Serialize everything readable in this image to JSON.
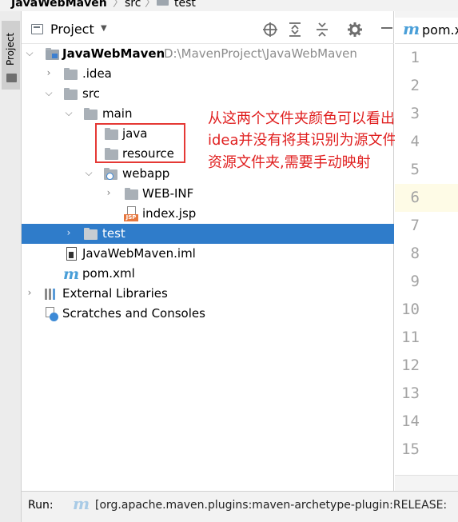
{
  "breadcrumb": {
    "project": "JavaWebMaven",
    "items": [
      "src",
      "test"
    ]
  },
  "tool_strip": {
    "project_tab": "Project"
  },
  "project_panel": {
    "title": "Project",
    "dropdown_icon": "chevron-down-icon",
    "toolbar_icons": [
      "locate-icon",
      "expand-all-icon",
      "collapse-all-icon",
      "gear-icon",
      "hide-icon"
    ]
  },
  "tree": {
    "root": {
      "name": "JavaWebMaven",
      "path": "D:\\MavenProject\\JavaWebMaven"
    },
    "idea": ".idea",
    "src": "src",
    "main": "main",
    "java": "java",
    "resource": "resource",
    "webapp": "webapp",
    "webinf": "WEB-INF",
    "indexjsp": "index.jsp",
    "test": "test",
    "iml": "JavaWebMaven.iml",
    "pom": "pom.xml",
    "external": "External Libraries",
    "scratches": "Scratches and Consoles",
    "jsp_tag": "JSP",
    "selected": "test"
  },
  "annotation": {
    "line1": "从这两个文件夹颜色可以看出,",
    "line2": "idea并没有将其识别为源文件夹和",
    "line3": "资源文件夹,需要手动映射",
    "color": "#e02020"
  },
  "editor": {
    "tab_label": "pom.xml",
    "line_numbers": [
      "1",
      "2",
      "3",
      "4",
      "5",
      "6",
      "7",
      "8",
      "9",
      "10",
      "11",
      "12",
      "13",
      "14",
      "15"
    ],
    "current_line": "6"
  },
  "run_bar": {
    "label": "Run:",
    "text": "[org.apache.maven.plugins:maven-archetype-plugin:RELEASE:"
  },
  "colors": {
    "selection": "#2f7cca",
    "folder": "#a9b0b7",
    "maven_blue": "#4a9fd8",
    "jsp_orange": "#e7773e"
  }
}
